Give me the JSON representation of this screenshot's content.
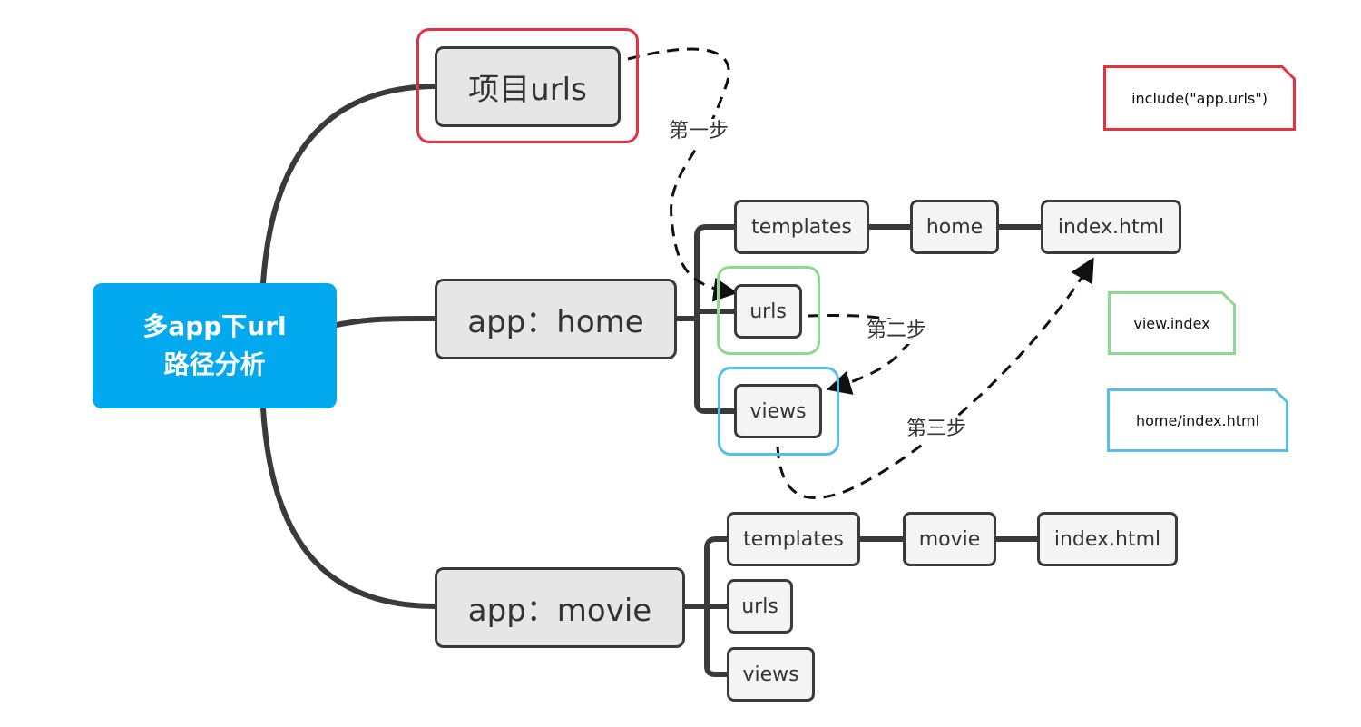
{
  "root": {
    "line1": "多app下url",
    "line2": "路径分析"
  },
  "project_urls": {
    "label": "项目urls"
  },
  "app_home": {
    "label": "app：home",
    "templates": "templates",
    "home_dir": "home",
    "index": "index.html",
    "urls": "urls",
    "views": "views"
  },
  "app_movie": {
    "label": "app：movie",
    "templates": "templates",
    "movie_dir": "movie",
    "index": "index.html",
    "urls": "urls",
    "views": "views"
  },
  "steps": {
    "step1": "第一步",
    "step2": "第二步",
    "step3": "第三步"
  },
  "notes": {
    "include": {
      "text": "include(\"app.urls\")",
      "color": "#e8313f"
    },
    "view_index": {
      "text": "view.index",
      "color": "#8fd88f"
    },
    "home_index": {
      "text": "home/index.html",
      "color": "#58bde8"
    }
  },
  "colors": {
    "root_bg": "#03a9ee",
    "line": "#3a3a3a",
    "red": "#e8313f",
    "green": "#8fd88f",
    "blue": "#58bde8"
  }
}
